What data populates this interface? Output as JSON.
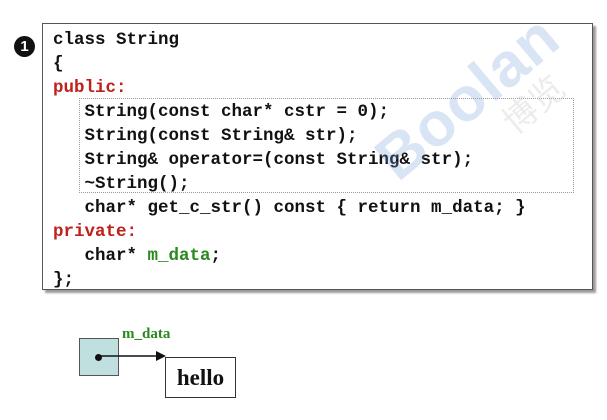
{
  "badge": {
    "number": "1"
  },
  "code": {
    "lines": [
      {
        "text": "class String",
        "color": "#111111"
      },
      {
        "text": "{",
        "color": "#111111"
      },
      {
        "text": "public:",
        "color": "#c0201a"
      },
      {
        "text": "   String(const char* cstr = 0);",
        "color": "#111111"
      },
      {
        "text": "   String(const String& str);",
        "color": "#111111"
      },
      {
        "text": "   String& operator=(const String& str);",
        "color": "#111111"
      },
      {
        "text": "   ~String();",
        "color": "#111111"
      },
      {
        "text": "   char* get_c_str() const { return m_data; }",
        "color": "#111111"
      },
      {
        "text": "private:",
        "color": "#c0201a"
      },
      {
        "text_prefix": "   char* ",
        "text_keyword": "m_data",
        "text_suffix": ";",
        "keyword_color": "#2a8a1e"
      },
      {
        "text": "};",
        "color": "#111111"
      }
    ]
  },
  "watermark": {
    "text": "Boolan",
    "cn_text": "博览"
  },
  "diagram": {
    "pointer_label": "m_data",
    "target_text": "hello",
    "pointer_fill": "#bfe0df"
  }
}
